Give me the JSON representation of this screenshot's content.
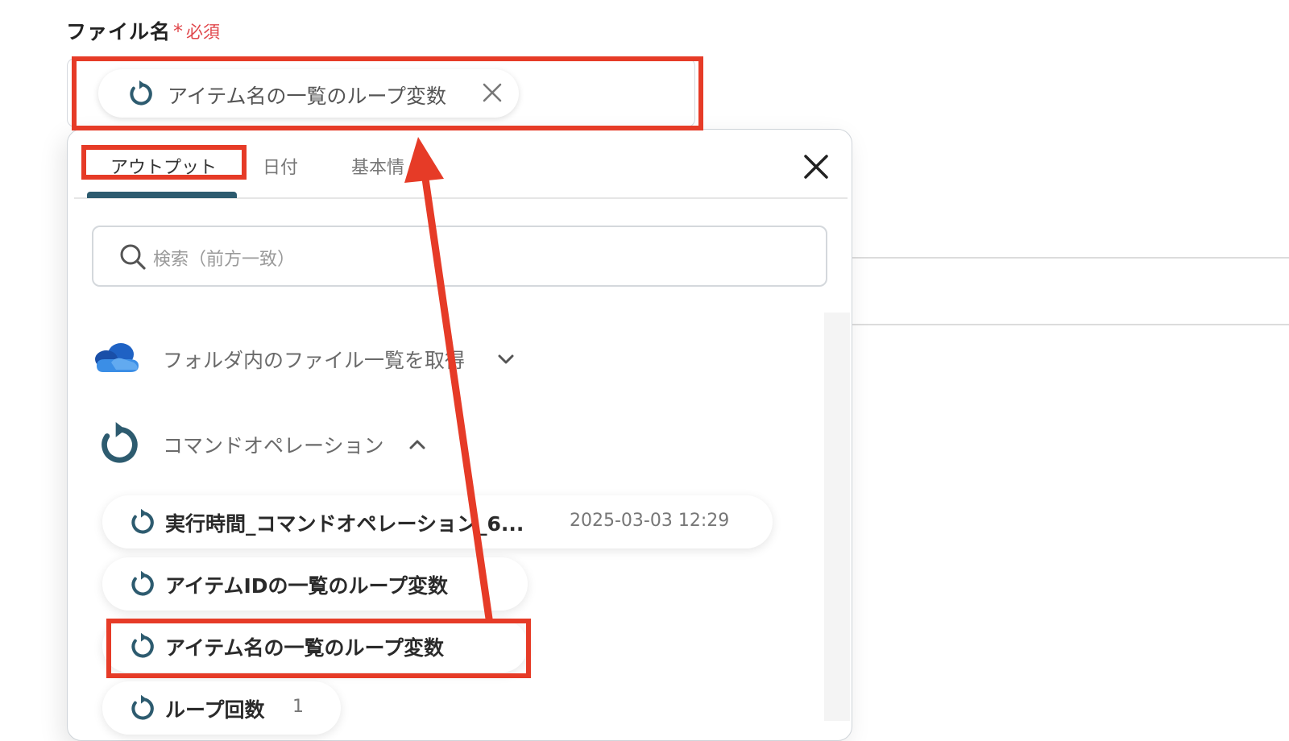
{
  "field": {
    "label": "ファイル名",
    "required_mark": "*",
    "required_text": "必須",
    "chip_label": "アイテム名の一覧のループ変数"
  },
  "tabs": [
    {
      "label": "アウトプット",
      "active": true
    },
    {
      "label": "日付",
      "active": false
    },
    {
      "label": "基本情",
      "active": false
    }
  ],
  "search": {
    "placeholder": "検索（前方一致）"
  },
  "sections": [
    {
      "label": "フォルダ内のファイル一覧を取得",
      "icon": "onedrive-cloud-icon",
      "expanded": false
    },
    {
      "label": "コマンドオペレーション",
      "icon": "loop-icon",
      "expanded": true
    }
  ],
  "items": [
    {
      "label": "実行時間_コマンドオペレーション_6...",
      "value": "2025-03-03 12:29"
    },
    {
      "label": "アイテムIDの一覧のループ変数",
      "value": ""
    },
    {
      "label": "アイテム名の一覧のループ変数",
      "value": ""
    },
    {
      "label": "ループ回数",
      "value": "1"
    }
  ],
  "colors": {
    "accent": "#2d5b6f",
    "annotation": "#e63b27",
    "required": "#e0474c"
  }
}
